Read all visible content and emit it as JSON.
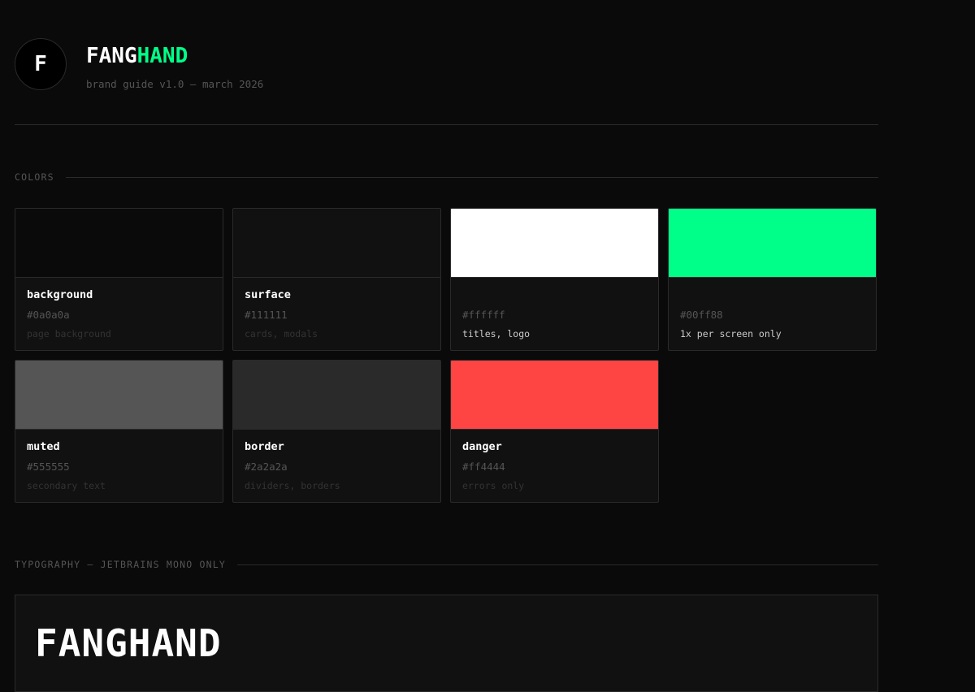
{
  "header": {
    "logo_letter": "F",
    "brand_part1": "FANG",
    "brand_part2": "HAND",
    "subtitle": "brand guide v1.0 — march 2026"
  },
  "sections": {
    "colors_label": "COLORS",
    "typography_label": "TYPOGRAPHY — JETBRAINS MONO ONLY"
  },
  "colors": [
    {
      "name": "background",
      "hex": "#0a0a0a",
      "desc": "page background",
      "swatch": "#0a0a0a"
    },
    {
      "name": "surface",
      "hex": "#111111",
      "desc": "cards, modals",
      "swatch": "#111111"
    },
    {
      "name": "",
      "hex": "#ffffff",
      "desc": "titles, logo",
      "swatch": "#ffffff"
    },
    {
      "name": "",
      "hex": "#00ff88",
      "desc": "1x per screen only",
      "swatch": "#00ff88"
    },
    {
      "name": "muted",
      "hex": "#555555",
      "desc": "secondary text",
      "swatch": "#555555"
    },
    {
      "name": "border",
      "hex": "#2a2a2a",
      "desc": "dividers, borders",
      "swatch": "#2a2a2a"
    },
    {
      "name": "danger",
      "hex": "#ff4444",
      "desc": "errors only",
      "swatch": "#ff4444"
    }
  ],
  "typography": {
    "sample": "FANGHAND"
  }
}
